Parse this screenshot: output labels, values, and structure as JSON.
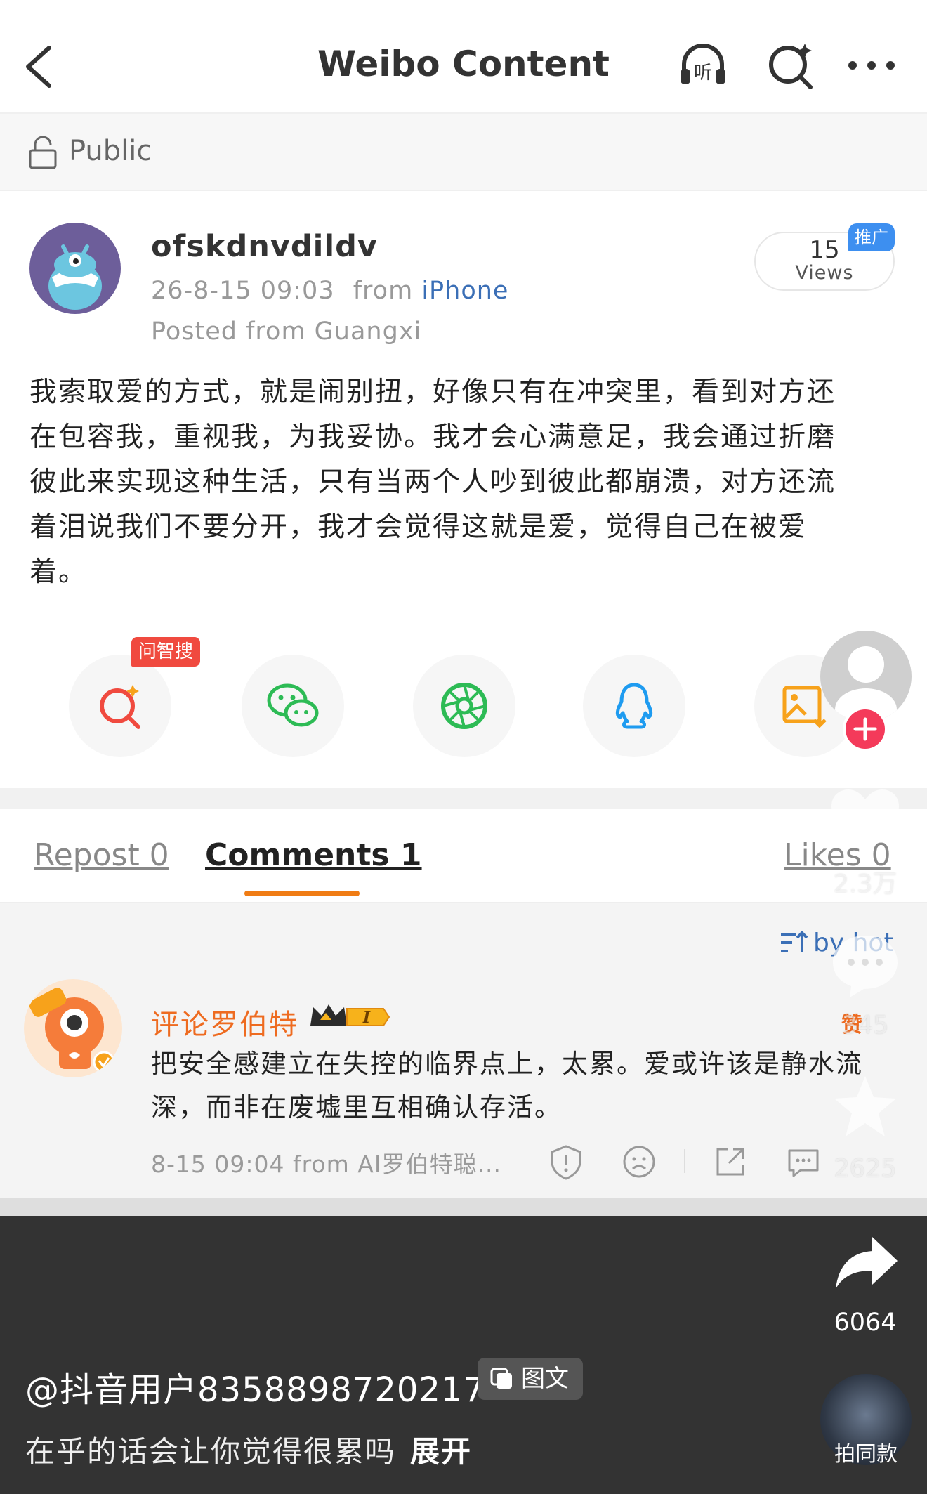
{
  "header": {
    "title": "Weibo Content"
  },
  "privacy": {
    "label": "Public"
  },
  "post": {
    "username": "ofskdnvdildv",
    "time": "26-8-15 09:03",
    "from_prefix": "from",
    "source": "iPhone",
    "location": "Posted from Guangxi",
    "views_count": "15",
    "views_label": "Views",
    "promo_badge": "推广",
    "content_lines": [
      "我索取爱的方式，就是闹别扭，好像只有在冲突里，看到对方还",
      "在包容我，重视我，为我妥协。我才会心满意足，我会通过折磨",
      "彼此来实现这种生活，只有当两个人吵到彼此都崩溃，对方还流",
      "着泪说我们不要分开，我才会觉得这就是爱，觉得自己在被爱",
      "着。"
    ]
  },
  "share": {
    "ask_badge": "问智搜"
  },
  "tabs": {
    "repost": "Repost 0",
    "comments": "Comments 1",
    "likes": "Likes 0"
  },
  "comments": {
    "sort_label": "by hot",
    "items": [
      {
        "name": "评论罗伯特",
        "level": "I",
        "author_tag": "赞",
        "text_lines": [
          "把安全感建立在失控的临界点上，太累。爱或许该是静水流",
          "深，而非在废墟里互相确认存活。"
        ],
        "meta": "8-15 09:04  from AI罗伯特聪...",
        "avatar_badge": "正版"
      }
    ]
  },
  "rail": {
    "likes": "2.3万",
    "comments": "345",
    "favorites": "2625",
    "shares": "6064",
    "same_style": "拍同款"
  },
  "douyin": {
    "user": "@抖音用户8358898720217",
    "tag": "图文",
    "desc": "在乎的话会让你觉得很累吗",
    "expand": "展开"
  },
  "colors": {
    "accent_orange": "#f07c14",
    "link_blue": "#3b6fb6",
    "follow_red": "#f43a5a"
  }
}
